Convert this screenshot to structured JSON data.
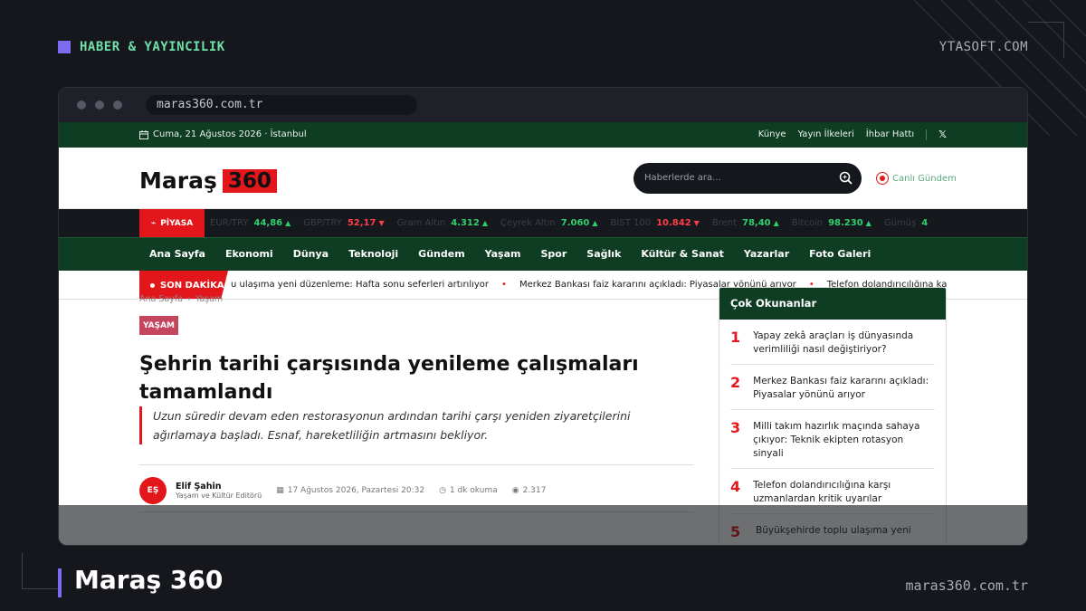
{
  "frame": {
    "category": "HABER & YAYINCILIK",
    "brand": "YTASOFT.COM",
    "site_title": "Maraş 360",
    "site_url": "maras360.com.tr"
  },
  "browser": {
    "url": "maras360.com.tr"
  },
  "site": {
    "date": "Cuma, 21 Ağustos 2026 · İstanbul",
    "top_links": [
      "Künye",
      "Yayın İlkeleri",
      "İhbar Hattı"
    ],
    "social_icon": "x-icon",
    "logo_word": "Maraş",
    "logo_num": "360",
    "search_placeholder": "Haberlerde ara...",
    "live_label": "Canlı Gündem",
    "market_label": "PİYASA",
    "market": [
      {
        "name": "EUR/TRY",
        "value": "44,86",
        "dir": "▲"
      },
      {
        "name": "GBP/TRY",
        "value": "52,17",
        "dir": "▼"
      },
      {
        "name": "Gram Altın",
        "value": "4.312",
        "dir": "▲"
      },
      {
        "name": "Çeyrek Altın",
        "value": "7.060",
        "dir": "▲"
      },
      {
        "name": "BIST 100",
        "value": "10.842",
        "dir": "▼"
      },
      {
        "name": "Brent",
        "value": "78,40",
        "dir": "▲"
      },
      {
        "name": "Bitcoin",
        "value": "98.230",
        "dir": "▲"
      },
      {
        "name": "Gümüş",
        "value": "4",
        "dir": ""
      }
    ],
    "nav": [
      "Ana Sayfa",
      "Ekonomi",
      "Dünya",
      "Teknoloji",
      "Gündem",
      "Yaşam",
      "Spor",
      "Sağlık",
      "Kültür & Sanat",
      "Yazarlar",
      "Foto Galeri"
    ],
    "breaking_label": "SON DAKİKA",
    "breaking": [
      "u ulaşıma yeni düzenleme: Hafta sonu seferleri artırılıyor",
      "Merkez Bankası faiz kararını açıkladı: Piyasalar yönünü arıyor",
      "Telefon dolandırıcılığına karşı uzmanla"
    ]
  },
  "article": {
    "breadcrumb": [
      "Ana Sayfa",
      "›",
      "Yaşam"
    ],
    "category": "YAŞAM",
    "title": "Şehrin tarihi çarşısında yenileme çalışmaları tamamlandı",
    "lead": "Uzun süredir devam eden restorasyonun ardından tarihi çarşı yeniden ziyaretçilerini ağırlamaya başladı. Esnaf, hareketliliğin artmasını bekliyor.",
    "author_initials": "EŞ",
    "author_name": "Elif Şahin",
    "author_role": "Yaşam ve Kültür Editörü",
    "date": "17 Ağustos 2026, Pazartesi 20:32",
    "read_time": "1 dk okuma",
    "views": "2.317"
  },
  "sidebar": {
    "title": "Çok Okunanlar",
    "items": [
      {
        "num": "1",
        "text": "Yapay zekâ araçları iş dünyasında verimliliği nasıl değiştiriyor?"
      },
      {
        "num": "2",
        "text": "Merkez Bankası faiz kararını açıkladı: Piyasalar yönünü arıyor"
      },
      {
        "num": "3",
        "text": "Milli takım hazırlık maçında sahaya çıkıyor: Teknik ekipten rotasyon sinyali"
      },
      {
        "num": "4",
        "text": "Telefon dolandırıcılığına karşı uzmanlardan kritik uyarılar"
      },
      {
        "num": "5",
        "text": "Büyükşehirde toplu ulaşıma yeni"
      }
    ]
  },
  "colors": {
    "accent_red": "#e3161b",
    "dark_green": "#0f3d23",
    "frame_purple": "#7c6cf2",
    "frame_green_text": "#6fe0a8"
  }
}
